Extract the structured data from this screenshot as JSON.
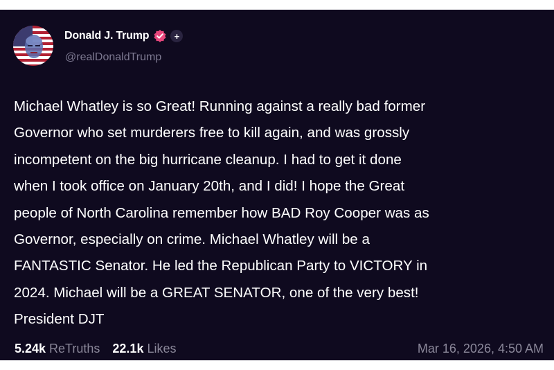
{
  "post": {
    "author": {
      "display_name": "Donald J. Trump",
      "handle": "@realDonaldTrump",
      "verified_badge_color": "#e8467c",
      "avatar": "flag-portrait-avatar"
    },
    "text": "Michael Whatley is so Great! Running against a really bad former\nGovernor who set murderers free to kill again, and was grossly\nincompetent on the big hurricane cleanup. I had to get it done\nwhen I took office on January 20th, and I did! I hope the Great\npeople of North Carolina remember how BAD Roy Cooper was as\nGovernor, especially on crime. Michael Whatley will be a\nFANTASTIC Senator. He led the Republican Party to VICTORY in\n2024. Michael will be a GREAT SENATOR, one of the very best!\nPresident DJT",
    "stats": {
      "retruths_count": "5.24k",
      "retruths_label": "ReTruths",
      "likes_count": "22.1k",
      "likes_label": "Likes"
    },
    "timestamp": "Mar 16, 2026, 4:50 AM"
  },
  "colors": {
    "card_background": "#0f0a1f",
    "text_primary": "#ffffff",
    "text_secondary": "#8a8799"
  }
}
